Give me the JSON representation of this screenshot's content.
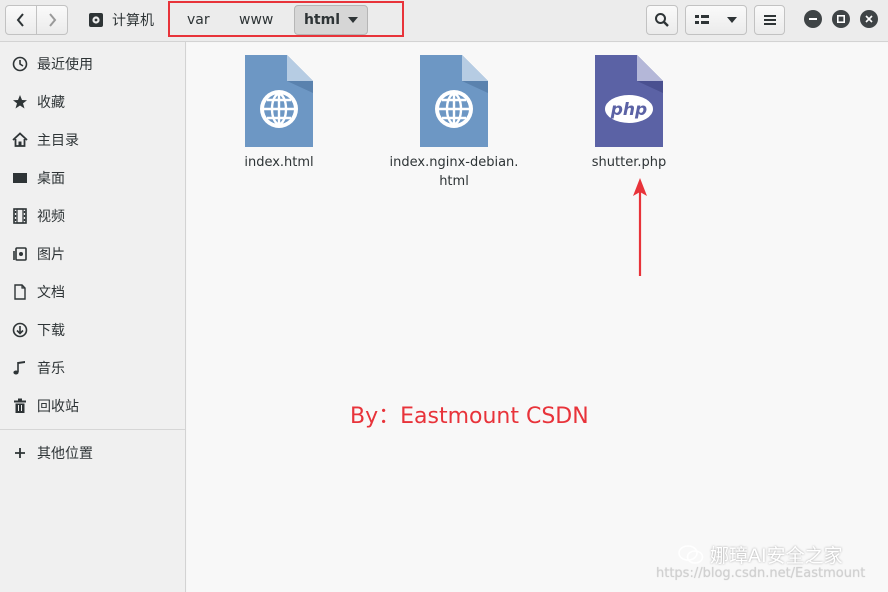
{
  "header": {
    "back_icon": "chevron-left-icon",
    "forward_icon": "chevron-right-icon",
    "computer_label": "计算机",
    "breadcrumbs": [
      "var",
      "www"
    ],
    "current_folder": "html"
  },
  "sidebar": {
    "items": [
      {
        "label": "最近使用",
        "icon": "recent-icon"
      },
      {
        "label": "收藏",
        "icon": "star-icon"
      },
      {
        "label": "主目录",
        "icon": "home-icon"
      },
      {
        "label": "桌面",
        "icon": "desktop-icon"
      },
      {
        "label": "视频",
        "icon": "video-icon"
      },
      {
        "label": "图片",
        "icon": "picture-icon"
      },
      {
        "label": "文档",
        "icon": "document-icon"
      },
      {
        "label": "下载",
        "icon": "download-icon"
      },
      {
        "label": "音乐",
        "icon": "music-icon"
      },
      {
        "label": "回收站",
        "icon": "trash-icon"
      }
    ],
    "other_locations": "其他位置"
  },
  "files": [
    {
      "name_line1": "index.html",
      "name_line2": "",
      "icon": "html-file-icon"
    },
    {
      "name_line1": "index.nginx-debian.",
      "name_line2": "html",
      "icon": "html-file-icon"
    },
    {
      "name_line1": "shutter.php",
      "name_line2": "",
      "icon": "php-file-icon",
      "badge": "php"
    }
  ],
  "annotation": {
    "text": "By：Eastmount CSDN",
    "color": "#e8333a"
  },
  "watermark": {
    "brand": "娜璋AI安全之家",
    "url": "https://blog.csdn.net/Eastmount"
  },
  "colors": {
    "html_icon": "#6d97c4",
    "php_icon": "#5b62a5",
    "highlight": "#e8333a"
  }
}
